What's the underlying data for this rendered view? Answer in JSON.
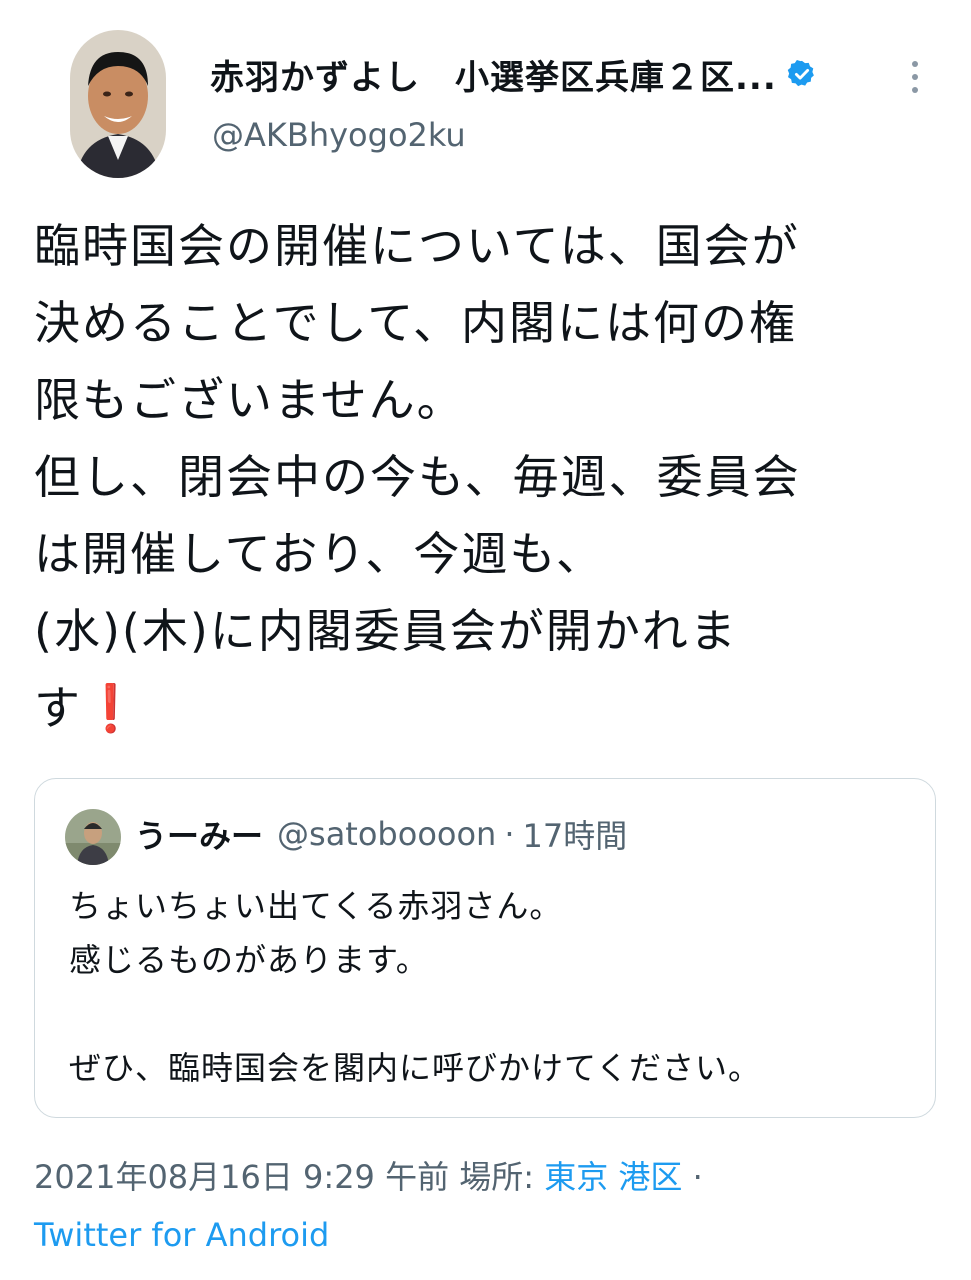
{
  "author": {
    "display_name": "赤羽かずよし　小選挙区兵庫２区...",
    "handle": "@AKBhyogo2ku",
    "verified_icon": "verified-badge-icon"
  },
  "tweet": {
    "text": "臨時国会の開催については、国会が\n決めることでして、内閣には何の権\n限もございません。\n但し、閉会中の今も、毎週、委員会\nは開催しており、今週も、\n(水)(木)に内閣委員会が開かれま\nす",
    "emoji": "❗"
  },
  "quote": {
    "name": "うーみー",
    "handle": "@satoboooon",
    "separator": "·",
    "time": "17時間",
    "text": "ちょいちょい出てくる赤羽さん。\n感じるものがあります。\n\nぜひ、臨時国会を閣内に呼びかけてください。"
  },
  "meta": {
    "timestamp": "2021年08月16日 9:29 午前",
    "location_label": "場所:",
    "location": "東京 港区",
    "separator": "·",
    "source": "Twitter for Android"
  },
  "colors": {
    "accent": "#1d9bf0",
    "muted": "#536471",
    "text": "#0f1419",
    "border": "#cfd9de",
    "exclamation": "#d0021b"
  }
}
